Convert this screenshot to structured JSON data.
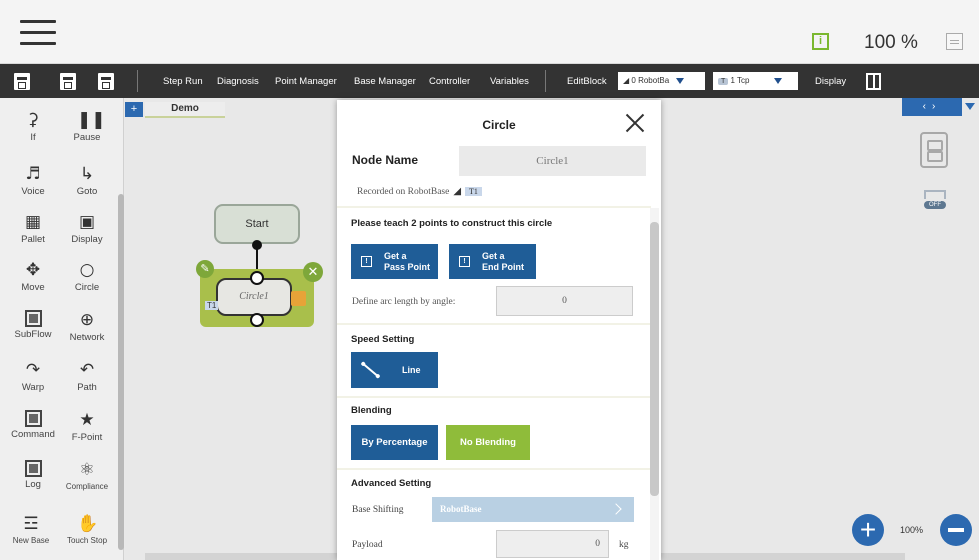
{
  "topbar": {
    "speed_percent": "100 %"
  },
  "toolbar": {
    "items": [
      "Step Run",
      "Diagnosis",
      "Point Manager",
      "Base Manager",
      "Controller",
      "Variables"
    ],
    "edit_block": "EditBlock",
    "base_dropdown": "0 RobotBa",
    "tcp_tag": "T",
    "tcp_dropdown": "1 Tcp",
    "display": "Display"
  },
  "sidebar": {
    "items": [
      {
        "label": "If",
        "icon": "if-branch-icon"
      },
      {
        "label": "Pause",
        "icon": "pause-icon"
      },
      {
        "label": "Voice",
        "icon": "voice-icon"
      },
      {
        "label": "Goto",
        "icon": "goto-arrow-icon"
      },
      {
        "label": "Pallet",
        "icon": "pallet-grid-icon"
      },
      {
        "label": "Display",
        "icon": "display-icon"
      },
      {
        "label": "Move",
        "icon": "move-cross-icon"
      },
      {
        "label": "Circle",
        "icon": "circle-icon"
      },
      {
        "label": "SubFlow",
        "icon": "subflow-icon"
      },
      {
        "label": "Network",
        "icon": "network-globe-icon"
      },
      {
        "label": "Warp",
        "icon": "warp-icon"
      },
      {
        "label": "Path",
        "icon": "path-icon"
      },
      {
        "label": "Command",
        "icon": "command-icon"
      },
      {
        "label": "F-Point",
        "icon": "f-point-icon"
      },
      {
        "label": "Log",
        "icon": "log-icon"
      },
      {
        "label": "Compliance",
        "icon": "compliance-icon"
      },
      {
        "label": "New Base",
        "icon": "new-base-icon"
      },
      {
        "label": "Touch Stop",
        "icon": "touch-stop-icon"
      }
    ]
  },
  "canvas": {
    "tab_name": "Demo",
    "start_node": "Start",
    "circle_node": "Circle1",
    "circle_node_tag": "T1",
    "zoom": "100%"
  },
  "dialog": {
    "title": "Circle",
    "node_name_label": "Node Name",
    "node_name_value": "Circle1",
    "recorded_on": "Recorded on RobotBase",
    "recorded_tag": "T1",
    "teach_heading": "Please teach 2 points to construct this circle",
    "pass_point": "Get a\nPass Point",
    "end_point": "Get a\nEnd Point",
    "arc_label": "Define arc length by angle:",
    "arc_value": "0",
    "speed_heading": "Speed Setting",
    "line_button": "Line",
    "blending_heading": "Blending",
    "by_percentage": "By Percentage",
    "no_blending": "No Blending",
    "advanced_heading": "Advanced Setting",
    "base_shifting_label": "Base Shifting",
    "base_shifting_value": "RobotBase",
    "payload_label": "Payload",
    "payload_value": "0",
    "payload_unit": "kg"
  },
  "colors": {
    "primary_blue": "#1f5d97",
    "selected_green": "#8fbc3a",
    "node_green": "#a9bf4b",
    "toolbar_dark": "#333333"
  }
}
